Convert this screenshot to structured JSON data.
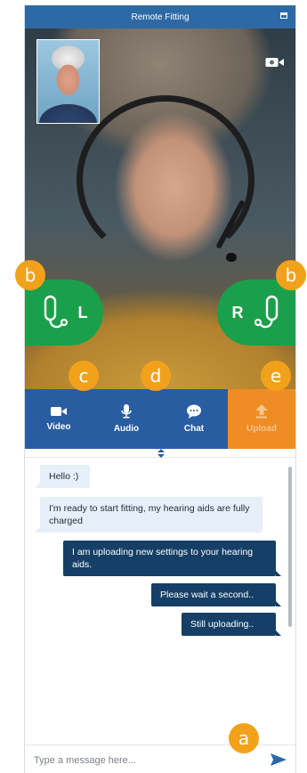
{
  "window": {
    "title": "Remote Fitting"
  },
  "hearing_aids": {
    "left_label": "L",
    "right_label": "R"
  },
  "toolbar": {
    "items": [
      {
        "label": "Video",
        "icon": "video-camera-icon"
      },
      {
        "label": "Audio",
        "icon": "microphone-icon"
      },
      {
        "label": "Chat",
        "icon": "chat-bubble-icon"
      },
      {
        "label": "Upload",
        "icon": "upload-arrow-icon"
      }
    ]
  },
  "chat": {
    "messages": [
      {
        "direction": "incoming",
        "text": "Hello :)"
      },
      {
        "direction": "incoming",
        "text": "I'm ready to start fitting, my hearing aids are fully charged"
      },
      {
        "direction": "outgoing",
        "text": "I am uploading new settings to your hearing aids."
      },
      {
        "direction": "outgoing",
        "text": "Please wait a second.."
      },
      {
        "direction": "outgoing",
        "text": "Still uploading.."
      }
    ],
    "input_placeholder": "Type a message here..."
  },
  "callouts": {
    "a": "a",
    "b": "b",
    "c": "c",
    "d": "d",
    "e": "e"
  },
  "colors": {
    "title_bar": "#2d6aa5",
    "toolbar": "#285da1",
    "upload_active": "#ef8c23",
    "hearing_aid_badge": "#1aa04a",
    "outgoing_bubble": "#153f66",
    "incoming_bubble": "#e7f0f9",
    "callout": "#f2a21a"
  }
}
